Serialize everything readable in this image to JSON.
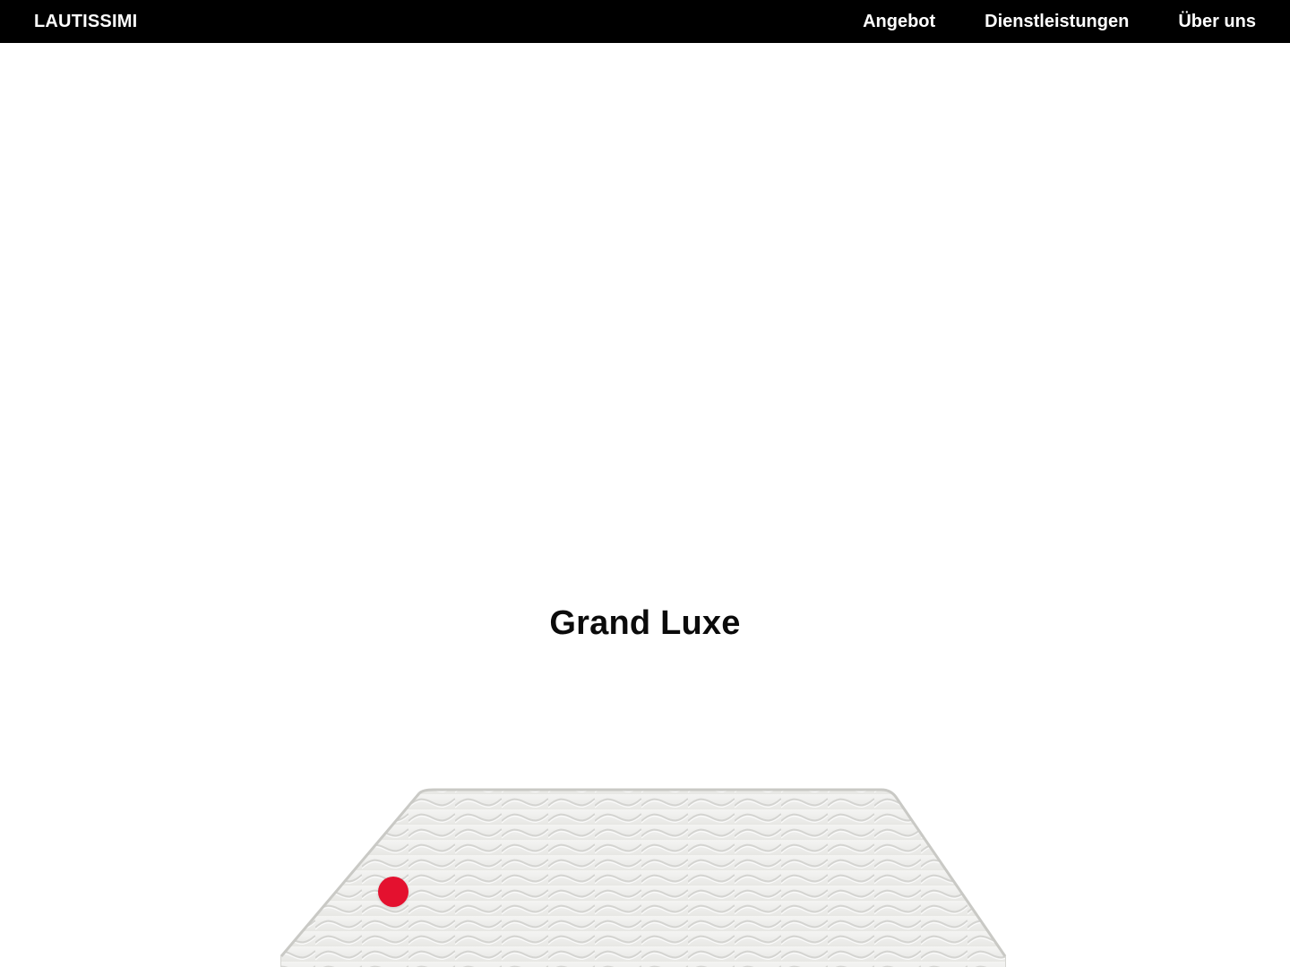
{
  "header": {
    "brand": "LAUTISSIMI",
    "nav": [
      {
        "label": "Angebot"
      },
      {
        "label": "Dienstleistungen"
      },
      {
        "label": "Über uns"
      }
    ]
  },
  "main": {
    "product_title": "Grand Luxe",
    "hotspot_color": "#e4112f"
  },
  "colors": {
    "header_bg": "#000000",
    "header_text": "#ffffff",
    "accent": "#e4112f"
  }
}
